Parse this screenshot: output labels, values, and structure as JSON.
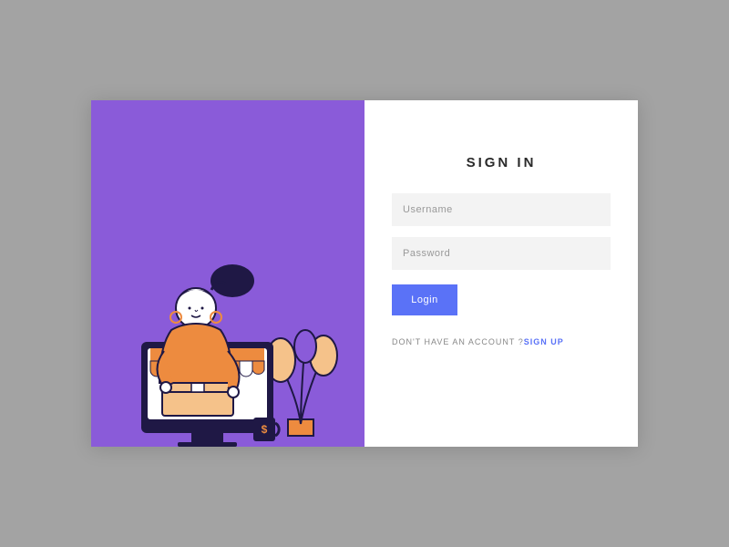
{
  "form": {
    "title": "SIGN IN",
    "username_placeholder": "Username",
    "password_placeholder": "Password",
    "login_label": "Login",
    "signup_prompt": "DON'T HAVE AN ACCOUNT ?",
    "signup_link_label": "SIGN UP"
  },
  "colors": {
    "accent_purple": "#8a5bd9",
    "button_blue": "#5a72f7",
    "input_bg": "#f3f3f3"
  }
}
